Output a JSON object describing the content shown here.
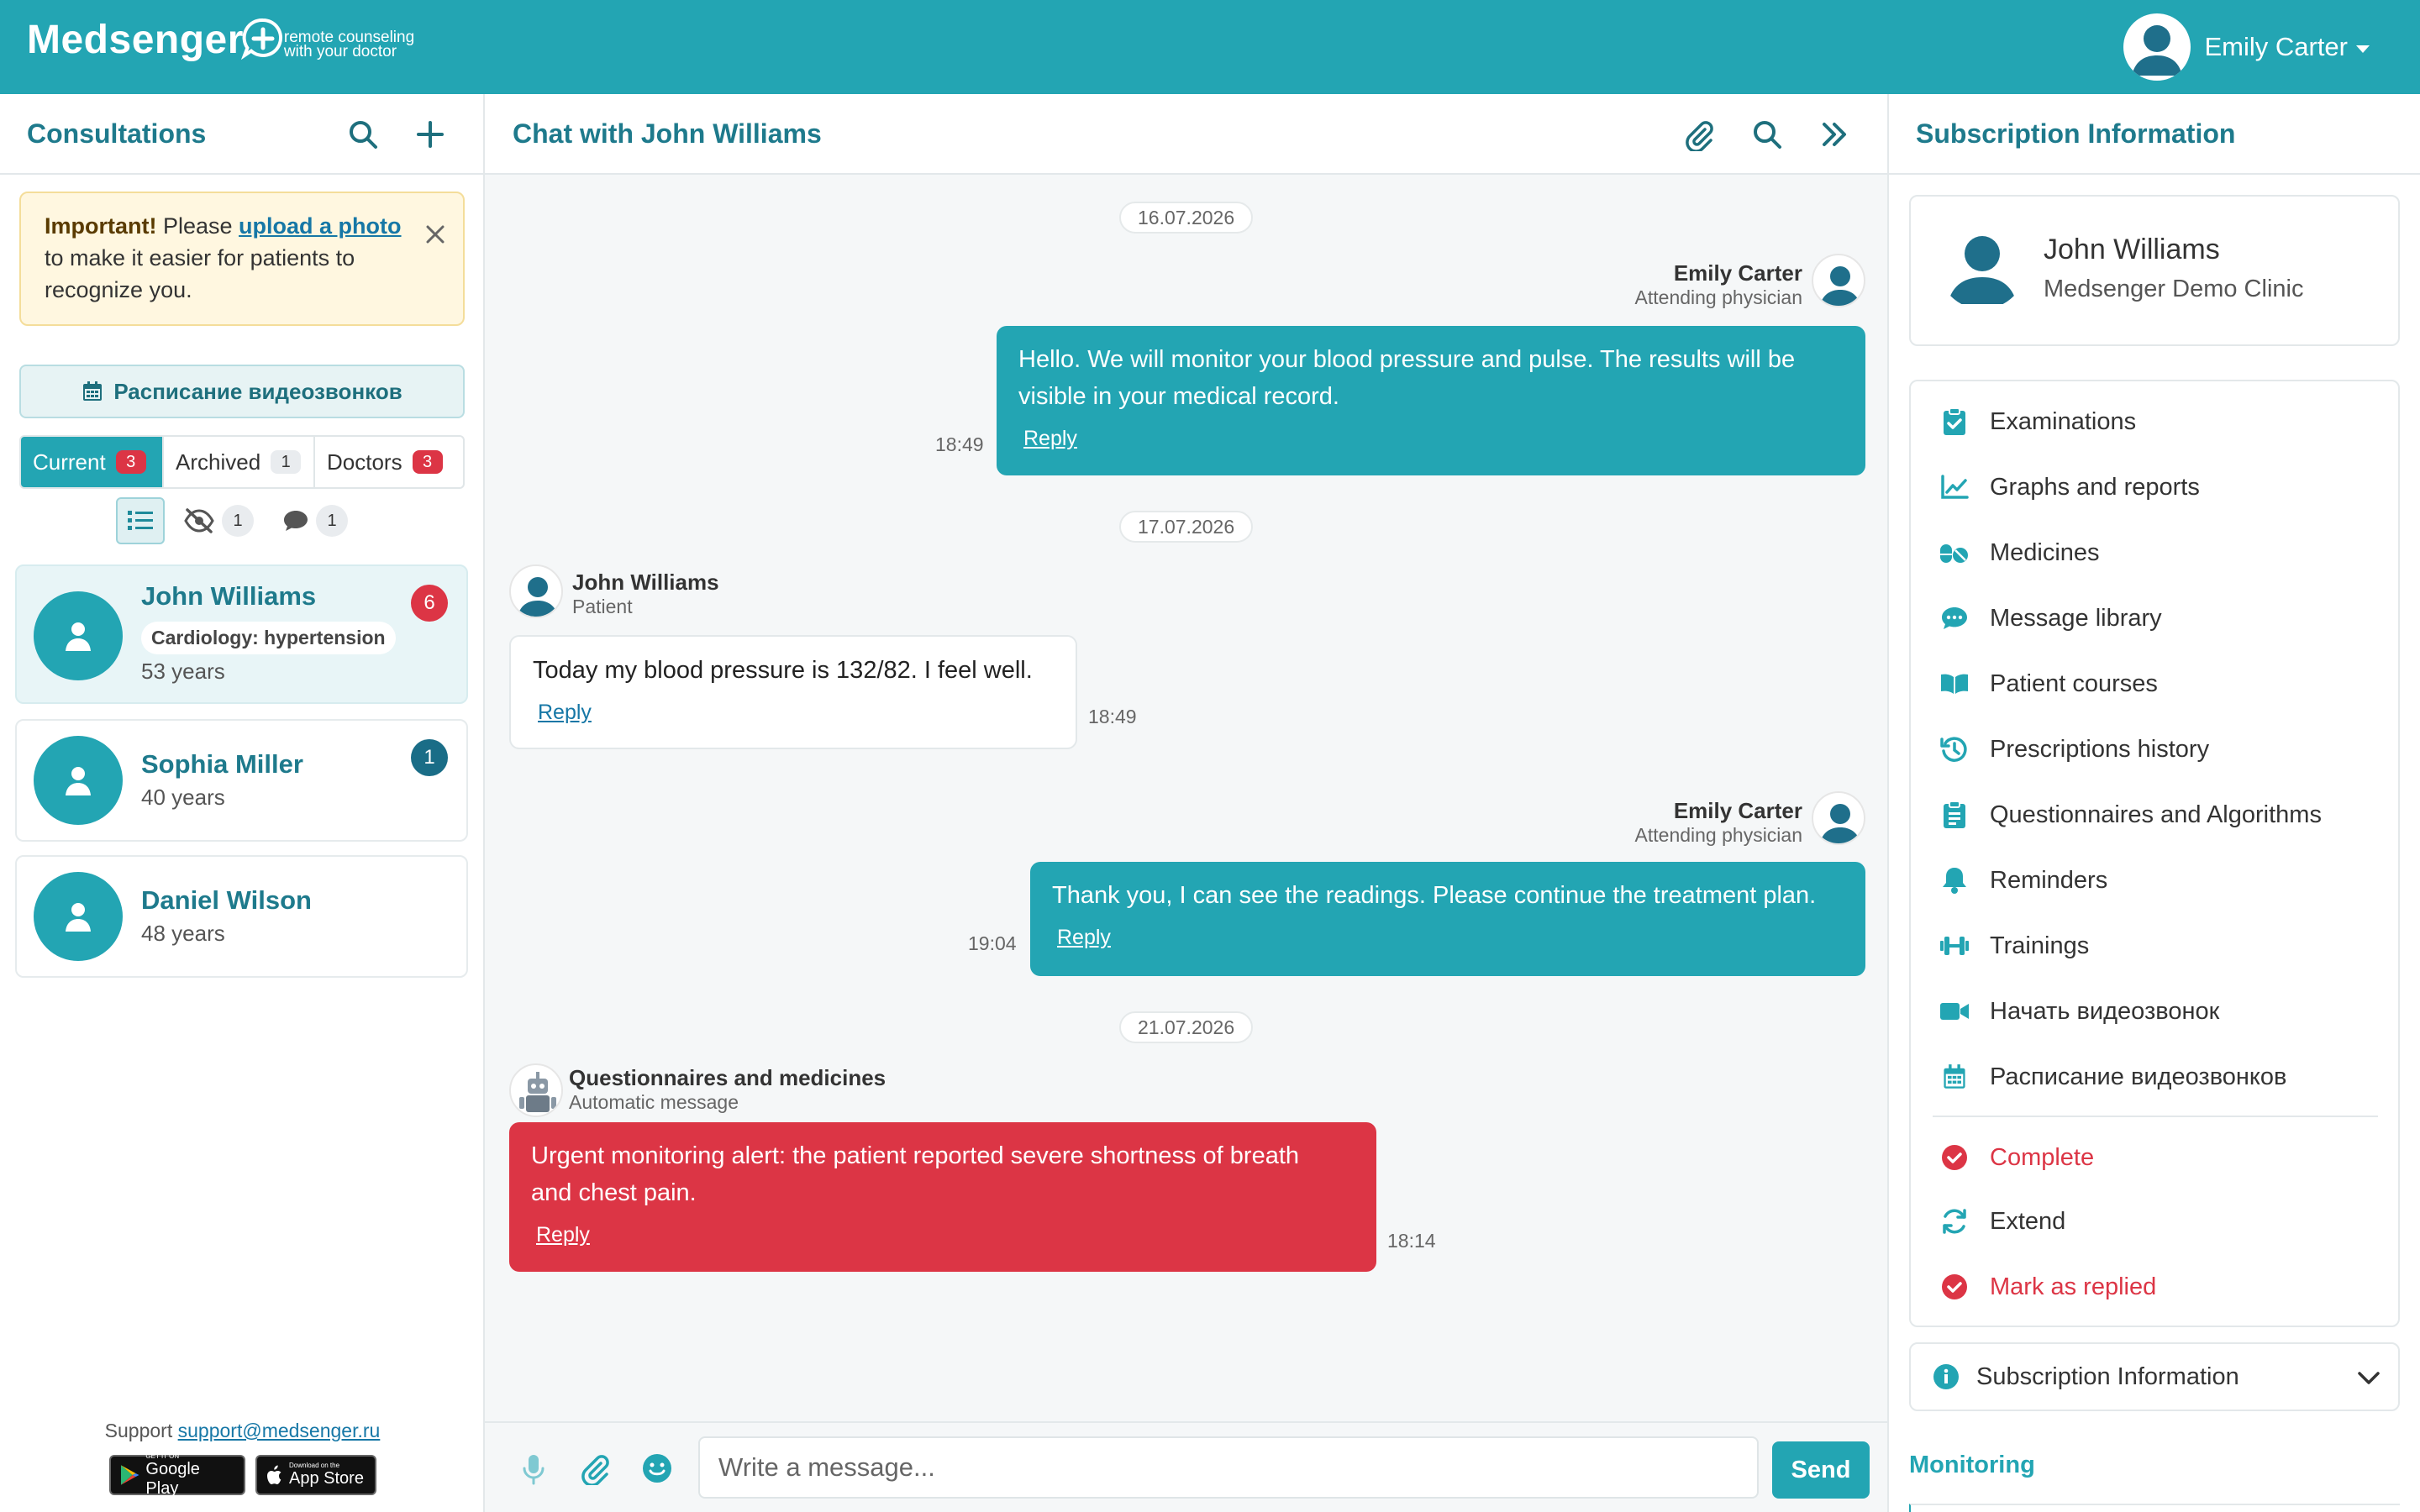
{
  "app": {
    "logo_text": "Medsenger",
    "tagline_1": "remote counseling",
    "tagline_2": "with your doctor",
    "brand_color": "#23a5b3",
    "alert_color": "#dc3545"
  },
  "user": {
    "name": "Emily Carter"
  },
  "left": {
    "title": "Consultations",
    "notice": {
      "strong": "Important!",
      "pre": " Please ",
      "link": "upload a photo",
      "rest": "to make it easier for patients to recognize you."
    },
    "schedule_button": "Расписание видеозвонков",
    "tabs": [
      {
        "label": "Current",
        "count": "3"
      },
      {
        "label": "Archived",
        "count": "1"
      },
      {
        "label": "Doctors",
        "count": "3"
      }
    ],
    "filters": {
      "hidden_count": "1",
      "messages_count": "1"
    },
    "patients": [
      {
        "name": "John Williams",
        "tag": "Cardiology: hypertension",
        "age": "53 years",
        "badge": "6"
      },
      {
        "name": "Sophia Miller",
        "age": "40 years",
        "badge": "1"
      },
      {
        "name": "Daniel Wilson",
        "age": "48 years"
      }
    ],
    "support_label": "Support",
    "support_email": "support@medsenger.ru",
    "google_small": "GET IT ON",
    "google_big": "Google Play",
    "apple_small": "Download on the",
    "apple_big": "App Store"
  },
  "chat": {
    "title": "Chat with John Williams",
    "reply_label": "Reply",
    "messages": [
      {
        "date": "16.07.2026"
      },
      {
        "sender": "Emily Carter",
        "role": "Attending physician",
        "text_1": "Hello. We will monitor your blood pressure and pulse. The results will be",
        "text_2": "visible in your medical record.",
        "time": "18:49"
      },
      {
        "date": "17.07.2026"
      },
      {
        "sender": "John Williams",
        "role": "Patient",
        "text": "Today my blood pressure is 132/82. I feel well.",
        "time": "18:49"
      },
      {
        "sender": "Emily Carter",
        "role": "Attending physician",
        "text": "Thank you, I can see the readings. Please continue the treatment plan.",
        "time": "19:04"
      },
      {
        "date": "21.07.2026"
      },
      {
        "sender": "Questionnaires and medicines",
        "role": "Automatic message",
        "text_1": "Urgent monitoring alert: the patient reported severe shortness of breath",
        "text_2": "and chest pain.",
        "time": "18:14"
      }
    ],
    "input_placeholder": "Write a message...",
    "send_label": "Send"
  },
  "right": {
    "title": "Subscription Information",
    "patient_name": "John Williams",
    "clinic": "Medsenger Demo Clinic",
    "menu": [
      {
        "label": "Examinations",
        "icon": "clipboard-check-icon"
      },
      {
        "label": "Graphs and reports",
        "icon": "chart-line-icon"
      },
      {
        "label": "Medicines",
        "icon": "pills-icon"
      },
      {
        "label": "Message library",
        "icon": "comment-dots-icon"
      },
      {
        "label": "Patient courses",
        "icon": "book-open-icon"
      },
      {
        "label": "Prescriptions history",
        "icon": "history-icon"
      },
      {
        "label": "Questionnaires and Algorithms",
        "icon": "clipboard-list-icon"
      },
      {
        "label": "Reminders",
        "icon": "bell-icon"
      },
      {
        "label": "Trainings",
        "icon": "dumbbell-icon"
      },
      {
        "label": "Начать видеозвонок",
        "icon": "video-icon"
      },
      {
        "label": "Расписание видеозвонков",
        "icon": "calendar-icon"
      }
    ],
    "actions": [
      {
        "label": "Complete",
        "icon": "check-circle-icon"
      },
      {
        "label": "Extend",
        "icon": "refresh-icon"
      },
      {
        "label": "Mark as replied",
        "icon": "check-circle-icon"
      }
    ],
    "accordion_label": "Subscription Information",
    "monitoring_label": "Monitoring"
  }
}
